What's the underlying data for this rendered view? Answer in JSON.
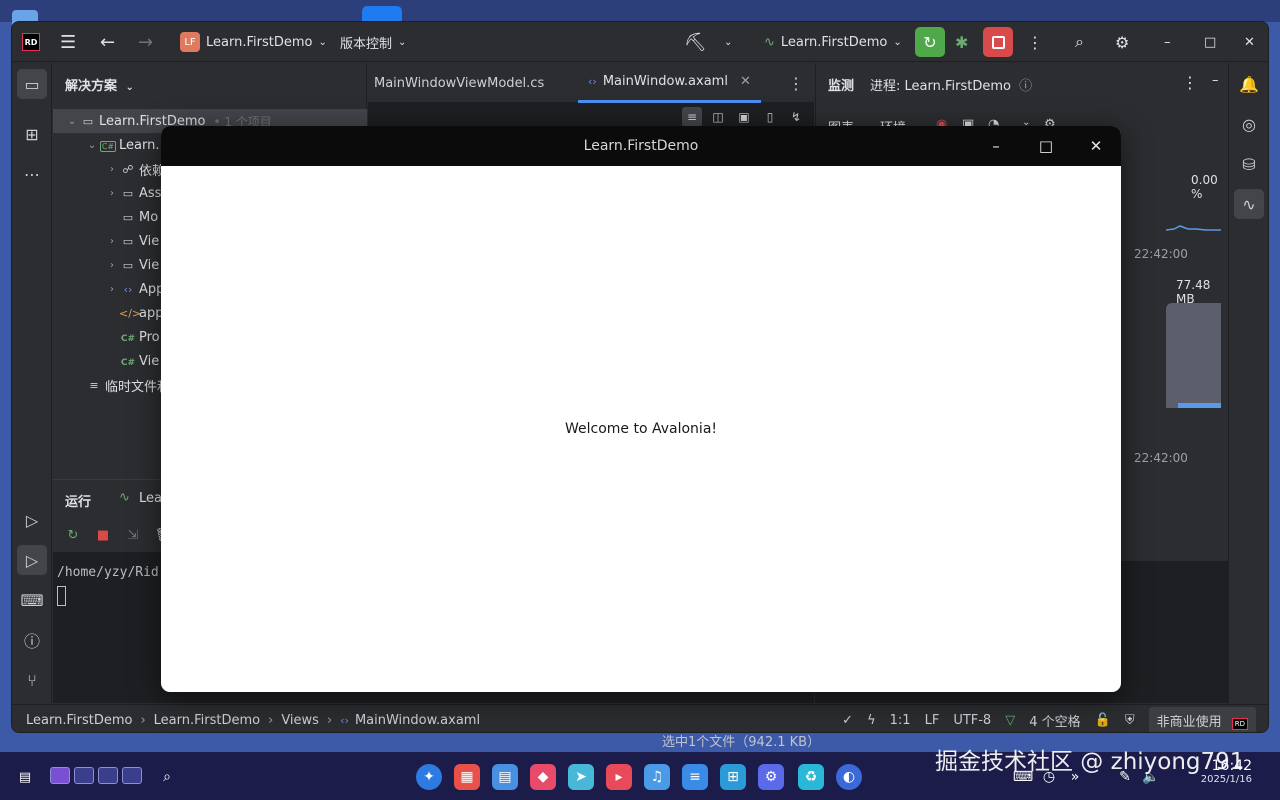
{
  "ide": {
    "project_name": "Learn.FirstDemo",
    "project_badge": "LF",
    "vcs_label": "版本控制",
    "run_config": "Learn.FirstDemo"
  },
  "solution": {
    "title": "解决方案",
    "items": [
      {
        "label": "Learn.FirstDemo",
        "suffix": "1 个项目"
      },
      {
        "label": "Learn."
      },
      {
        "label": "依赖"
      },
      {
        "label": "Ass"
      },
      {
        "label": "Mo"
      },
      {
        "label": "Vie"
      },
      {
        "label": "Vie"
      },
      {
        "label": "App"
      },
      {
        "label": "app"
      },
      {
        "label": "Pro"
      },
      {
        "label": "Vie"
      },
      {
        "label": "临时文件和"
      }
    ]
  },
  "editor": {
    "tabs": [
      {
        "label": "MainWindowViewModel.cs"
      },
      {
        "label": "MainWindow.axaml"
      }
    ]
  },
  "monitor": {
    "title": "监测",
    "process_label": "进程: Learn.FirstDemo",
    "tab_chart": "图表",
    "tab_env": "环境",
    "cpu_percent": "0.00 %",
    "time1": "22:42:00",
    "memory": "77.48 MB",
    "time2": "22:42:00"
  },
  "run": {
    "title": "运行",
    "tab_label": "Lear",
    "console_line": "/home/yzy/Rid"
  },
  "statusbar": {
    "crumbs": [
      "Learn.FirstDemo",
      "Learn.FirstDemo",
      "Views",
      "MainWindow.axaml"
    ],
    "position": "1:1",
    "line_ending": "LF",
    "encoding": "UTF-8",
    "indent": "4 个空格",
    "license": "非商业使用"
  },
  "below_status": "选中1个文件（942.1 KB）",
  "app_window": {
    "title": "Learn.FirstDemo",
    "welcome": "Welcome to Avalonia!"
  },
  "taskbar": {
    "time": "16:42",
    "date": "2025/1/16"
  },
  "watermark": "掘金技术社区 @ zhiyong791",
  "colors": {
    "ide_bg": "#2b2d30",
    "editor_bg": "#1e1f22",
    "accent": "#4b8ef0",
    "run_green": "#4fa84a",
    "stop_red": "#d94a4a",
    "taskbar": "#1b1c4a"
  }
}
